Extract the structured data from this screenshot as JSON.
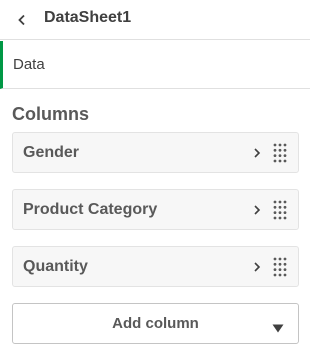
{
  "header": {
    "title": "DataSheet1",
    "back_icon": "chevron-left-icon"
  },
  "section": {
    "label": "Data",
    "accent_color": "#009845"
  },
  "columns": {
    "heading": "Columns",
    "items": [
      {
        "label": "Gender"
      },
      {
        "label": "Product Category"
      },
      {
        "label": "Quantity"
      }
    ]
  },
  "add_column": {
    "label": "Add column",
    "icon": "caret-down-icon"
  }
}
